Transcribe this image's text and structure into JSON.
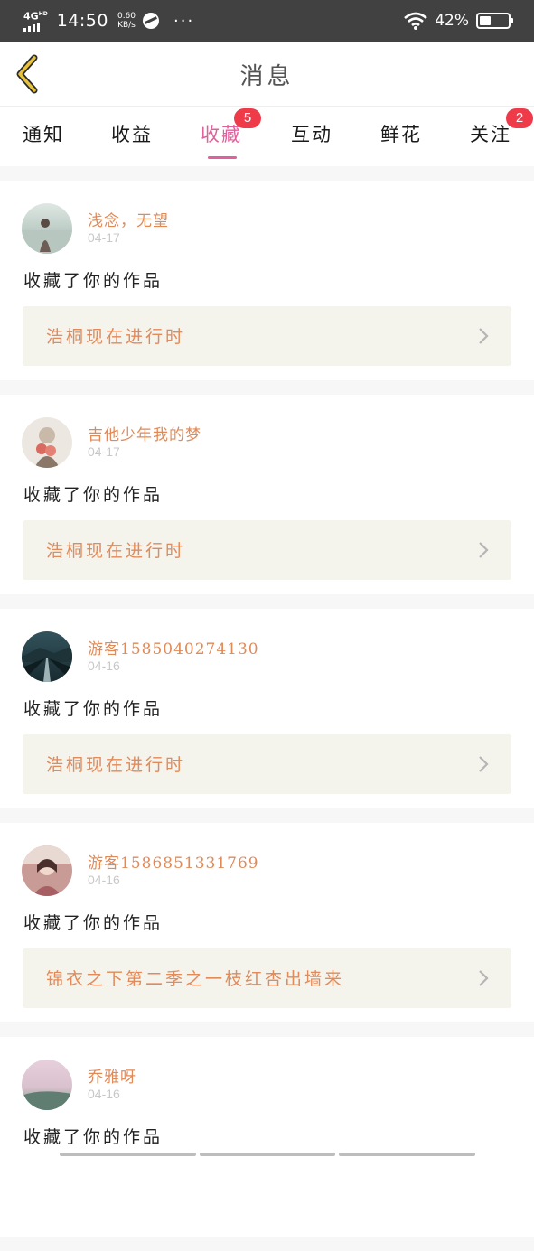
{
  "status_bar": {
    "network": "4G",
    "network_sup": "HD",
    "time": "14:50",
    "speed_value": "0.60",
    "speed_unit": "KB/s",
    "overflow": "···",
    "battery_percent": "42%",
    "battery_level": 0.42
  },
  "header": {
    "title": "消息",
    "back_icon": "chevron-left-icon",
    "back_color": "#e8c33a"
  },
  "tabs": [
    {
      "label": "通知",
      "active": false,
      "badge": ""
    },
    {
      "label": "收益",
      "active": false,
      "badge": ""
    },
    {
      "label": "收藏",
      "active": true,
      "badge": "5"
    },
    {
      "label": "互动",
      "active": false,
      "badge": ""
    },
    {
      "label": "鲜花",
      "active": false,
      "badge": ""
    },
    {
      "label": "关注",
      "active": false,
      "badge": "2"
    }
  ],
  "colors": {
    "accent": "#e0609c",
    "badge": "#ef3a4a",
    "username": "#e08a58",
    "work_title": "#e28a5a",
    "work_bg": "#f4f3ec",
    "date": "#c8c8c8"
  },
  "messages": [
    {
      "user": "浅念，无望",
      "date": "04-17",
      "action": "收藏了你的作品",
      "work": "浩桐现在进行时",
      "avatar": "girl-by-lake-avatar"
    },
    {
      "user": "吉他少年我的梦",
      "date": "04-17",
      "action": "收藏了你的作品",
      "work": "浩桐现在进行时",
      "avatar": "girl-with-flowers-avatar"
    },
    {
      "user": "游客1585040274130",
      "date": "04-16",
      "action": "收藏了你的作品",
      "work": "浩桐现在进行时",
      "avatar": "road-landscape-avatar"
    },
    {
      "user": "游客1586851331769",
      "date": "04-16",
      "action": "收藏了你的作品",
      "work": "锦衣之下第二季之一枝红杏出墙来",
      "avatar": "girl-pink-avatar"
    },
    {
      "user": "乔雅呀",
      "date": "04-16",
      "action": "收藏了你的作品",
      "work": "",
      "avatar": "pink-sky-landscape-avatar"
    }
  ]
}
